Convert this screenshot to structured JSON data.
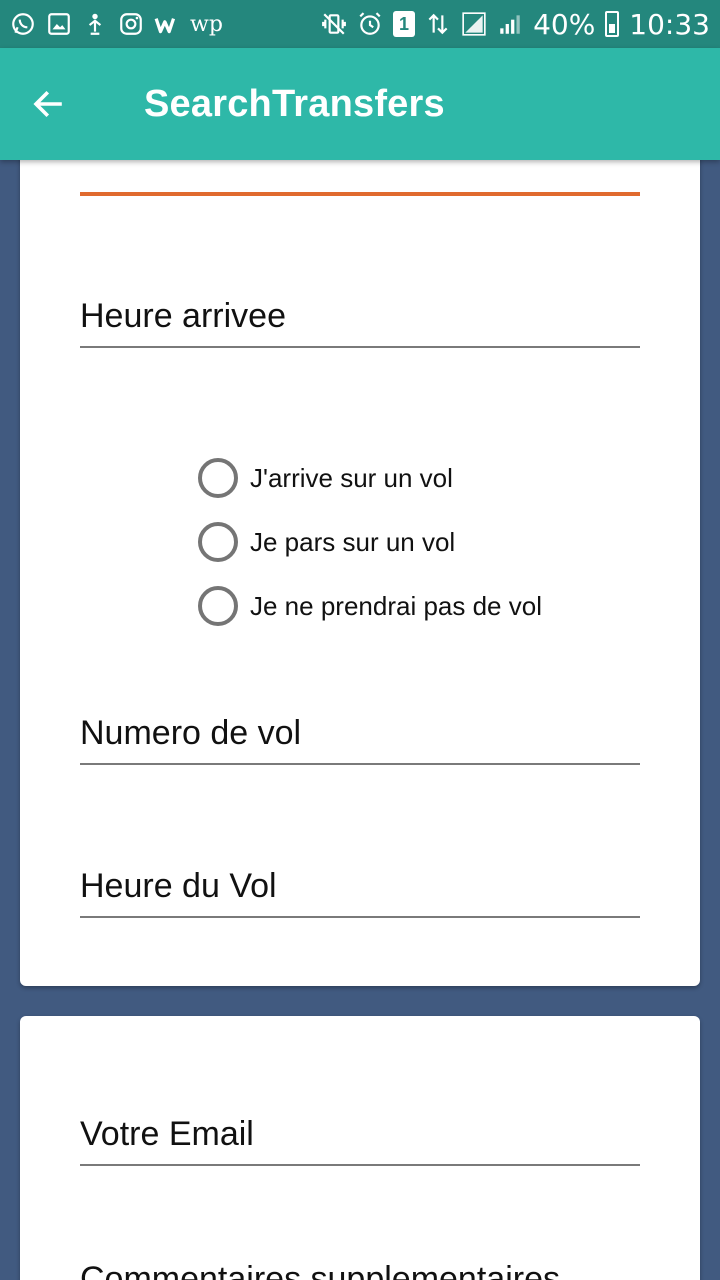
{
  "status_bar": {
    "battery": "40%",
    "time": "10:33",
    "sim_badge": "1",
    "wp_text": "wp",
    "icons_left": [
      "whatsapp-icon",
      "gallery-icon",
      "upload-icon",
      "instagram-icon",
      "wattpad-icon",
      "wp-icon"
    ],
    "icons_right": [
      "vibrate-icon",
      "alarm-icon",
      "sim-icon",
      "data-arrows-icon",
      "signal-sim1-icon",
      "signal-sim2-icon",
      "battery-icon"
    ]
  },
  "app_bar": {
    "title": "SearchTransfers",
    "back_icon": "back-arrow-icon"
  },
  "form": {
    "heure_arrivee": "Heure arrivee",
    "flight_options": [
      {
        "label": "J'arrive sur un vol"
      },
      {
        "label": "Je pars sur un vol"
      },
      {
        "label": "Je ne prendrai pas de vol"
      }
    ],
    "numero_vol": "Numero de vol",
    "heure_vol": "Heure du Vol",
    "email": "Votre Email",
    "commentaires": "Commentaires supplementaires"
  },
  "colors": {
    "status_bar": "#24877d",
    "app_bar": "#2eb8a8",
    "background": "#415a80",
    "accent_line": "#e06a2e"
  }
}
